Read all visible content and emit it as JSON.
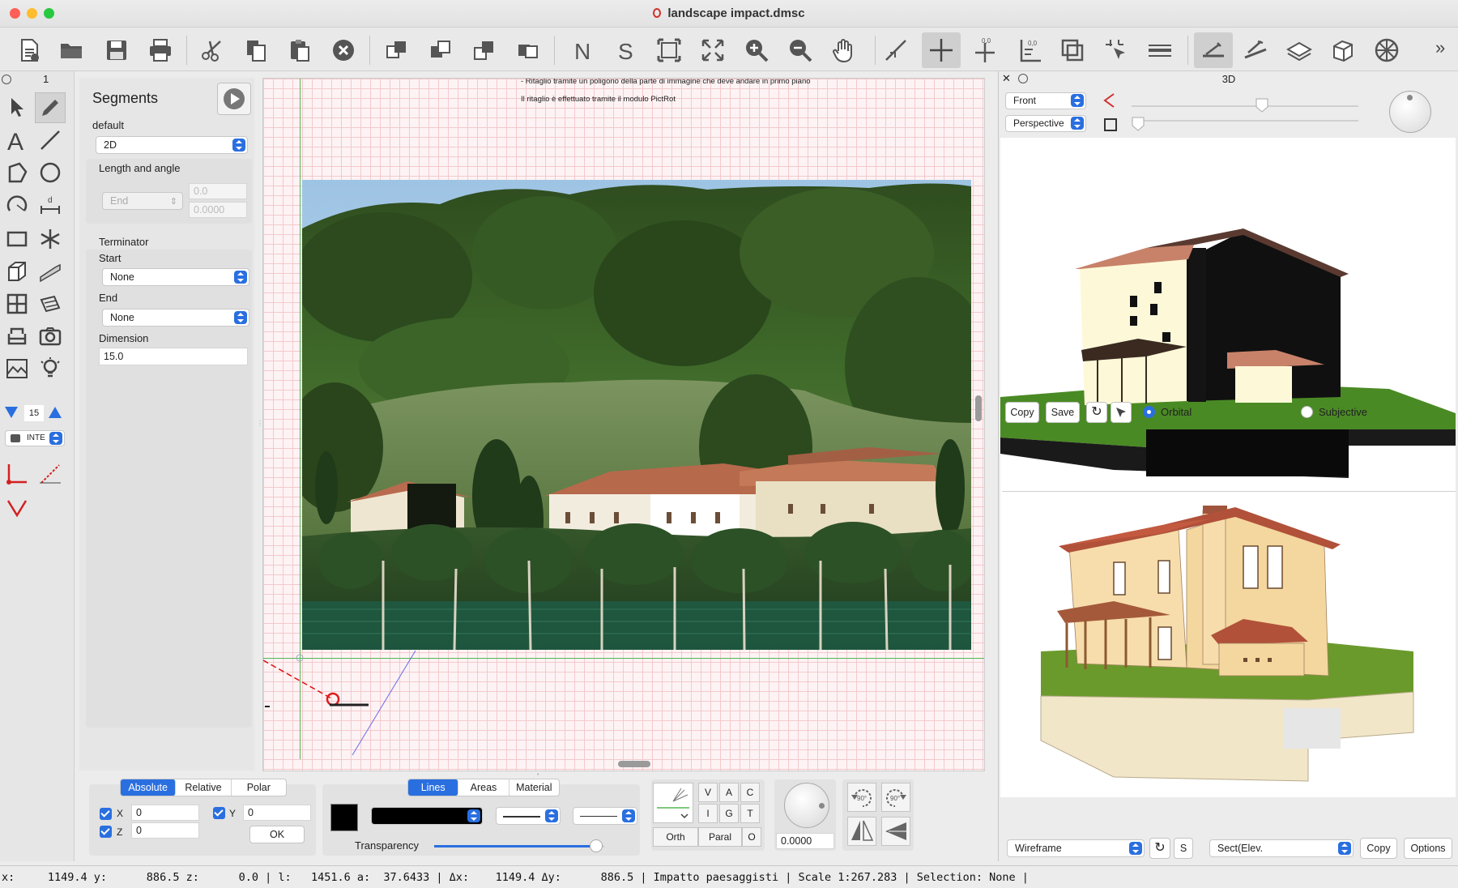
{
  "window": {
    "title": "landscape impact.dmsc"
  },
  "toolbar": {
    "items": [
      "new-file",
      "open-folder",
      "save",
      "print",
      "cut",
      "copy",
      "paste",
      "delete",
      "tool-a",
      "tool-b",
      "tool-c",
      "tool-d",
      "north",
      "south",
      "fit-selection",
      "fit-all",
      "zoom-in",
      "zoom-out",
      "pan-hand",
      "line-tool",
      "cross-tool",
      "point-tool",
      "ortho-tool",
      "box-tool",
      "snap-tool",
      "lines-tool",
      "layer-1",
      "layer-2",
      "layer-3",
      "layer-4",
      "wheel"
    ],
    "more": "»"
  },
  "left": {
    "tab_number": "1",
    "line_width": "15",
    "inte": "INTE"
  },
  "panel": {
    "title": "Segments",
    "mode_label": "default",
    "mode_value": "2D",
    "length_angle_label": "Length and angle",
    "end_placeholder": "End",
    "length_value": "0.0",
    "angle_value": "0.0000",
    "terminator_label": "Terminator",
    "start_label": "Start",
    "start_value": "None",
    "end_label": "End",
    "end_value": "None",
    "dimension_label": "Dimension",
    "dimension_value": "15.0"
  },
  "canvas": {
    "note1": "- Ritaglio tramite un poligono della parte di immagine che deve andare in primo piano",
    "note2": "Il ritaglio è effettuato tramite il modulo PictRot"
  },
  "view3d": {
    "title": "3D",
    "view_select": "Front",
    "projection_select": "Perspective",
    "copy": "Copy",
    "save": "Save",
    "orbital": "Orbital",
    "subjective": "Subjective",
    "render_select": "Wireframe",
    "s_button": "S",
    "section_select": "Sect(Elev.",
    "copy2": "Copy",
    "options": "Options"
  },
  "bottom": {
    "coord_tabs": [
      "Absolute",
      "Relative",
      "Polar"
    ],
    "x_label": "X",
    "x_value": "0",
    "y_label": "Y",
    "y_value": "0",
    "z_label": "Z",
    "z_value": "0",
    "ok": "OK",
    "attr_tabs": [
      "Lines",
      "Areas",
      "Material"
    ],
    "transparency": "Transparency",
    "transparency_level": 0.95,
    "keys": [
      "V",
      "A",
      "C",
      "I",
      "G",
      "T"
    ],
    "orth": "Orth",
    "paral": "Paral",
    "o": "O",
    "angle_value": "0.0000"
  },
  "status": {
    "text": "x:     1149.4 y:      886.5 z:      0.0 | l:   1451.6 a:  37.6433 | Δx:    1149.4 Δy:      886.5 | Impatto paesaggisti | Scale 1:267.283 | Selection: None |"
  },
  "colors": {
    "accent": "#2a6fe0",
    "grid": "#f3c9cd",
    "guide_green": "#53b753",
    "snap_red": "#e01b1b"
  }
}
